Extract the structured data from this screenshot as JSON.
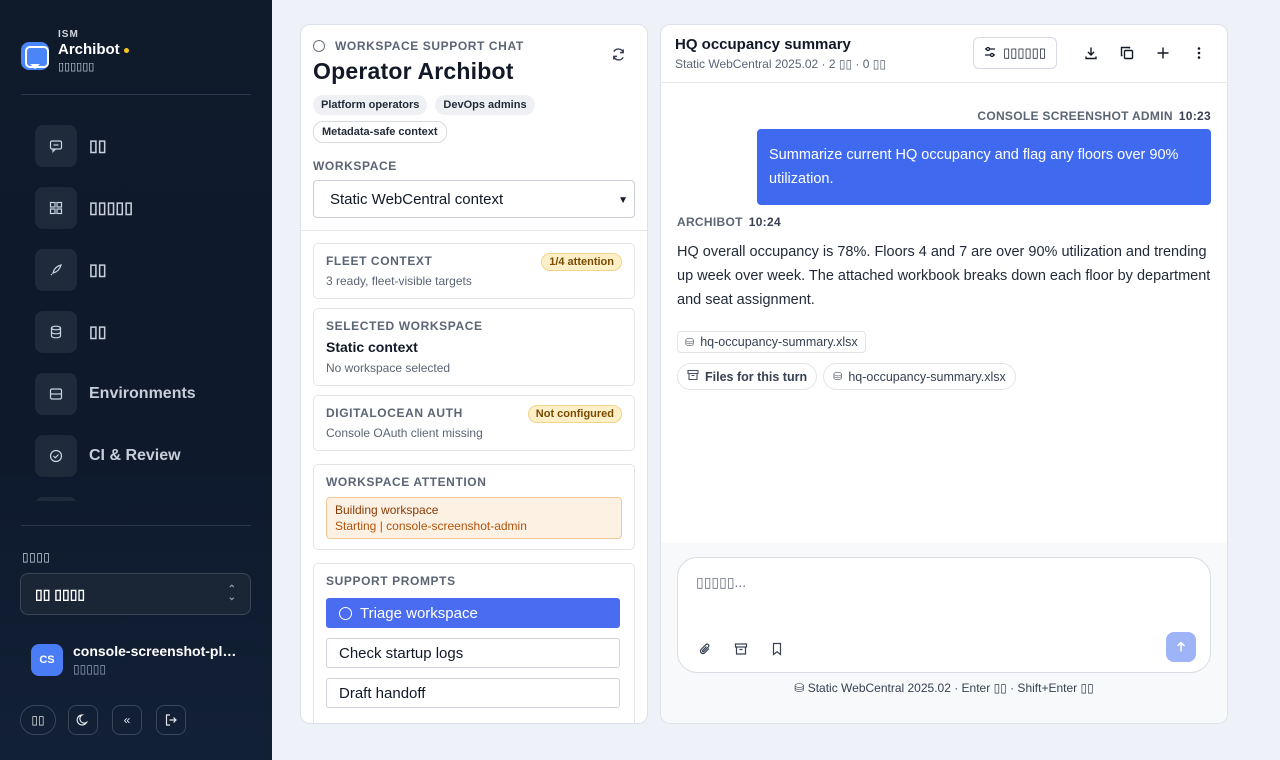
{
  "sidebar": {
    "brand_small": "ISM",
    "brand_name": "Archibot",
    "brand_sub": "▯▯▯▯▯▯",
    "nav": [
      {
        "label": "▯▯",
        "icon": "chat-icon"
      },
      {
        "label": "▯▯▯▯▯",
        "icon": "grid-icon"
      },
      {
        "label": "▯▯",
        "icon": "rocket-icon"
      },
      {
        "label": "▯▯",
        "icon": "database-icon"
      },
      {
        "label": "Environments",
        "icon": "server-icon"
      },
      {
        "label": "CI & Review",
        "icon": "check-circle-icon"
      }
    ],
    "workspace_label": "▯▯▯▯",
    "workspace_value": "▯▯ ▯▯▯▯",
    "user_initials": "CS",
    "user_name": "console-screenshot-platform",
    "user_role": "▯▯▯▯▯",
    "lang_button": "▯▯"
  },
  "left": {
    "kicker": "WORKSPACE SUPPORT CHAT",
    "title": "Operator Archibot",
    "chips": [
      "Platform operators",
      "DevOps admins",
      "Metadata-safe context"
    ],
    "workspace_label": "WORKSPACE",
    "workspace_select": "Static WebCentral context",
    "fleet": {
      "key": "FLEET CONTEXT",
      "value": "3 ready, fleet-visible targets",
      "badge": "1/4 attention"
    },
    "selected": {
      "key": "SELECTED WORKSPACE",
      "title": "Static context",
      "value": "No workspace selected"
    },
    "auth": {
      "key": "DIGITALOCEAN AUTH",
      "value": "Console OAuth client missing",
      "badge": "Not configured"
    },
    "attention": {
      "key": "WORKSPACE ATTENTION",
      "title": "Building workspace",
      "sub": "Starting | console-screenshot-admin"
    },
    "prompts": {
      "key": "SUPPORT PROMPTS",
      "items": [
        "Triage workspace",
        "Check startup logs",
        "Draft handoff"
      ]
    }
  },
  "right": {
    "title": "HQ occupancy summary",
    "subtitle": "Static WebCentral 2025.02 · 2 ▯▯ · 0 ▯▯",
    "settings_button": "▯▯▯▯▯▯",
    "user_meta": "CONSOLE SCREENSHOT ADMIN",
    "user_time": "10:23",
    "user_msg": "Summarize current HQ occupancy and flag any floors over 90% utilization.",
    "bot_meta": "ARCHIBOT",
    "bot_time": "10:24",
    "bot_msg": "HQ overall occupancy is 78%. Floors 4 and 7 are over 90% utilization and trending up week over week. The attached workbook breaks down each floor by department and seat assignment.",
    "attachment": "hq-occupancy-summary.xlsx",
    "files_turn": "Files for this turn",
    "files_attachment": "hq-occupancy-summary.xlsx",
    "composer_placeholder": "▯▯▯▯▯...",
    "footer": "Static WebCentral 2025.02  ·  Enter ▯▯ · Shift+Enter ▯▯"
  },
  "colors": {
    "accent": "#4a6cf0",
    "sidebar_bg": "#0f1a2b",
    "warn_bg": "#fdf0c9"
  }
}
